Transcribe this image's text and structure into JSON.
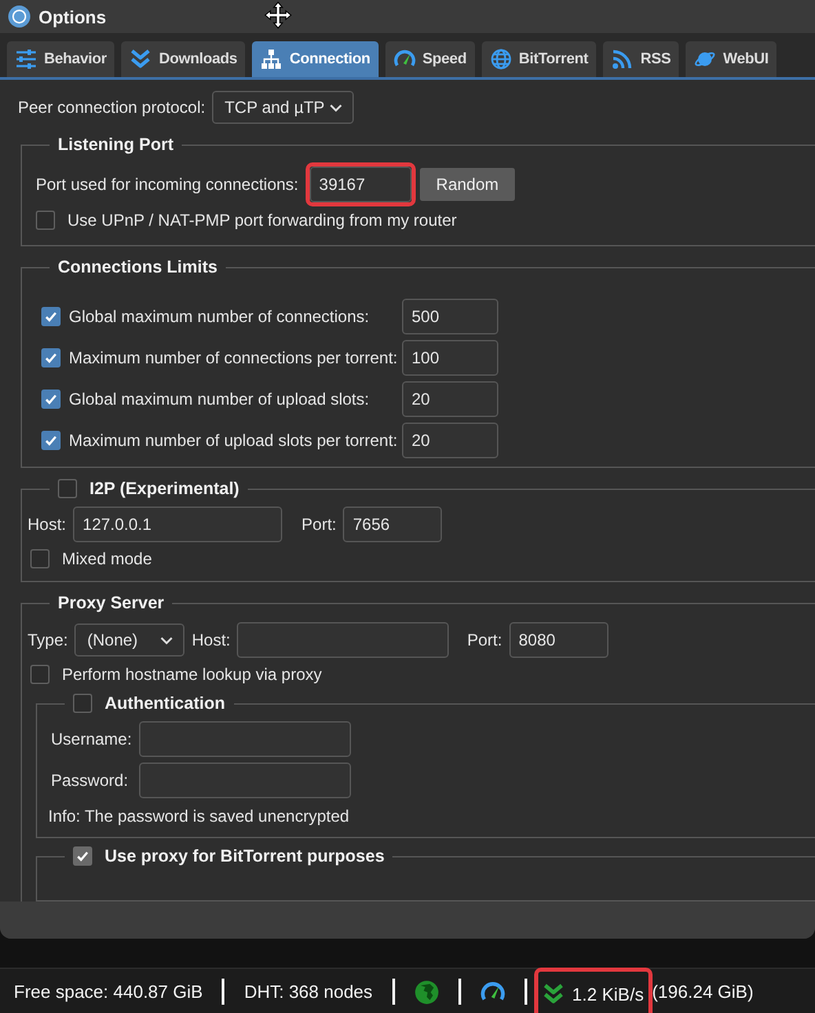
{
  "window": {
    "title": "Options"
  },
  "tabs": [
    {
      "label": "Behavior",
      "selected": false
    },
    {
      "label": "Downloads",
      "selected": false
    },
    {
      "label": "Connection",
      "selected": true
    },
    {
      "label": "Speed",
      "selected": false
    },
    {
      "label": "BitTorrent",
      "selected": false
    },
    {
      "label": "RSS",
      "selected": false
    },
    {
      "label": "WebUI",
      "selected": false
    }
  ],
  "peer_protocol": {
    "label": "Peer connection protocol:",
    "value": "TCP and µTP"
  },
  "listening_port": {
    "title": "Listening Port",
    "port_label": "Port used for incoming connections:",
    "port": "39167",
    "highlighted": true,
    "random_button": "Random",
    "upnp": {
      "label": "Use UPnP / NAT-PMP port forwarding from my router",
      "checked": false
    }
  },
  "connection_limits": {
    "title": "Connections Limits",
    "rows": [
      {
        "label": "Global maximum number of connections:",
        "checked": true,
        "value": "500"
      },
      {
        "label": "Maximum number of connections per torrent:",
        "checked": true,
        "value": "100"
      },
      {
        "label": "Global maximum number of upload slots:",
        "checked": true,
        "value": "20"
      },
      {
        "label": "Maximum number of upload slots per torrent:",
        "checked": true,
        "value": "20"
      }
    ]
  },
  "i2p": {
    "title": "I2P (Experimental)",
    "checked": false,
    "host_label": "Host:",
    "host": "127.0.0.1",
    "port_label": "Port:",
    "port": "7656",
    "mixed_mode": {
      "label": "Mixed mode",
      "checked": false
    }
  },
  "proxy": {
    "title": "Proxy Server",
    "type_label": "Type:",
    "type": "(None)",
    "host_label": "Host:",
    "port_label": "Port:",
    "port": "8080",
    "hostname_lookup": {
      "label": "Perform hostname lookup via proxy",
      "checked": false
    },
    "authentication": {
      "title": "Authentication",
      "checked": false,
      "username_label": "Username:",
      "password_label": "Password:",
      "info": "Info: The password is saved unencrypted"
    },
    "bittorrent_purposes": {
      "label": "Use proxy for BitTorrent purposes",
      "checked": true,
      "disabled": true
    }
  },
  "status_bar": {
    "free_space": "Free space: 440.87 GiB",
    "dht": "DHT: 368 nodes",
    "download_speed": "1.2 KiB/s",
    "download_total": "(196.24 GiB)",
    "highlighted": true
  }
}
